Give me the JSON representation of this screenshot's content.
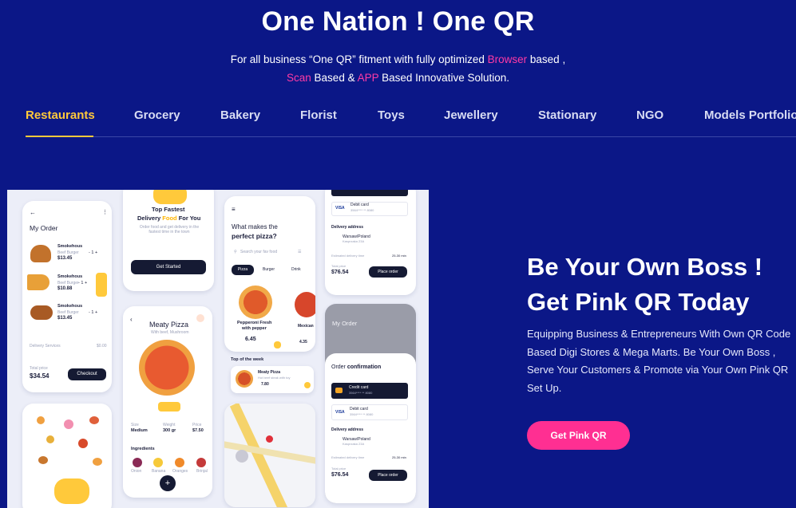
{
  "hero": {
    "title": "One Nation ! One QR",
    "line1_a": "For all business “One QR” fitment with fully optimized ",
    "line1_pink": "Browser",
    "line1_b": " based ,",
    "line2_pink1": "Scan",
    "line2_a": " Based & ",
    "line2_pink2": "APP",
    "line2_b": " Based Innovative Solution."
  },
  "tabs": [
    {
      "label": "Restaurants",
      "active": true
    },
    {
      "label": "Grocery"
    },
    {
      "label": "Bakery"
    },
    {
      "label": "Florist"
    },
    {
      "label": "Toys"
    },
    {
      "label": "Jewellery"
    },
    {
      "label": "Stationary"
    },
    {
      "label": "NGO"
    },
    {
      "label": "Models Portfolio"
    }
  ],
  "mockup": {
    "my_order": "My Order",
    "items": [
      {
        "name": "Smokehous",
        "sub": "Beef Burger",
        "price": "$13.45",
        "qty": "- 1 +"
      },
      {
        "name": "Smokehous",
        "sub": "Beef Burger",
        "price": "$10.88",
        "qty": "- 1 +"
      },
      {
        "name": "Smokehous",
        "sub": "Beef Burger",
        "price": "$13.45",
        "qty": "- 1 +"
      }
    ],
    "delivery_services": "Delivery Services",
    "delivery_fee": "$0.00",
    "total_price_label": "Total price",
    "total_price": "$34.54",
    "checkout": "Checkout",
    "top_fastest": "Top Fastest",
    "delivery_a": "Delivery ",
    "delivery_food": "Food",
    "delivery_b": " For You",
    "delivery_desc": "Order food and get delivery in the fastest time in the town",
    "get_started": "Get Started",
    "meaty_pizza": "Meaty Pizza",
    "meaty_sub": "With beef, Mushroom",
    "size_label": "Size",
    "size_val": "Medium",
    "weight_label": "Weight",
    "weight_val": "300 gr",
    "price_label": "Price",
    "price_val": "$7.50",
    "ingredients": "Ingredients",
    "ingredient_names": [
      "Onion",
      "Banana",
      "Oranges",
      "Brinjal"
    ],
    "what_makes": "What makes the",
    "perfect_pizza": "perfect pizza?",
    "search_placeholder": "Search your fav food",
    "cats": [
      "Pizza",
      "Burger",
      "Drink"
    ],
    "pepperoni": "Pepperoni Fresh",
    "with_pepper": "with pepper",
    "pep_price": "6.45",
    "mexican": "Mexican",
    "mex_price": "4.35",
    "top_week": "Top of the week",
    "meaty_small": "Meaty Pizza",
    "meaty_small_sub": "Hot beef steak with toy",
    "meaty_small_price": "7.80",
    "debit_card": "Debit card",
    "card_num": "3564**** ** 8080",
    "delivery_address": "Delivery address",
    "warsaw": "Warsaw/Poland",
    "warsaw_sub": "Kasprzaka 23A",
    "est_time": "Estimated  delivery time",
    "est_val": "25-30 min",
    "total_price_2": "$76.54",
    "place_order": "Place order",
    "my_order_2": "My Order",
    "order_conf_a": "Order ",
    "order_conf_b": "confirmation",
    "credit_card": "Credit card",
    "credit_num": "3564**** ** 8080",
    "visa": "VISA"
  },
  "right": {
    "title1": "Be Your Own Boss !",
    "title2": "Get Pink QR Today",
    "description": "Equipping Business & Entrepreneurs With Own QR Code Based Digi Stores & Mega Marts. Be Your Own Boss , Serve Your Customers & Promote via Your Own Pink QR Set Up.",
    "cta": "Get Pink QR"
  },
  "colors": {
    "background": "#0b1787",
    "accent_yellow": "#ffc93b",
    "accent_pink": "#ff2f92"
  }
}
